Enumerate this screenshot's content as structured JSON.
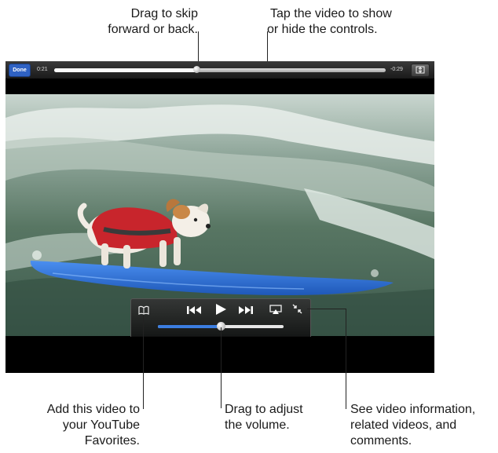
{
  "callouts": {
    "drag_skip": [
      "Drag to skip",
      "forward or back."
    ],
    "tap_video": [
      "Tap the video to show",
      "or hide the controls."
    ],
    "add_favorites": [
      "Add this video to",
      "your YouTube",
      "Favorites."
    ],
    "drag_volume": [
      "Drag to adjust",
      "the volume."
    ],
    "see_info": [
      "See video information,",
      "related videos, and",
      "comments."
    ]
  },
  "player": {
    "done_label": "Done",
    "elapsed": "0:21",
    "remaining": "-0:29",
    "progress_fraction": 0.43,
    "volume_fraction": 0.5,
    "icons": {
      "fit": "fit-screen-icon",
      "bookmark": "bookmark-icon",
      "previous": "previous-track-icon",
      "play": "play-icon",
      "next": "next-track-icon",
      "airplay": "airplay-icon",
      "info": "shrink-info-icon"
    }
  },
  "colors": {
    "done_button": "#2f62c4",
    "volume_fill": "#3b7de0",
    "surfboard": "#2a6fd6",
    "life_vest": "#c8252c"
  }
}
